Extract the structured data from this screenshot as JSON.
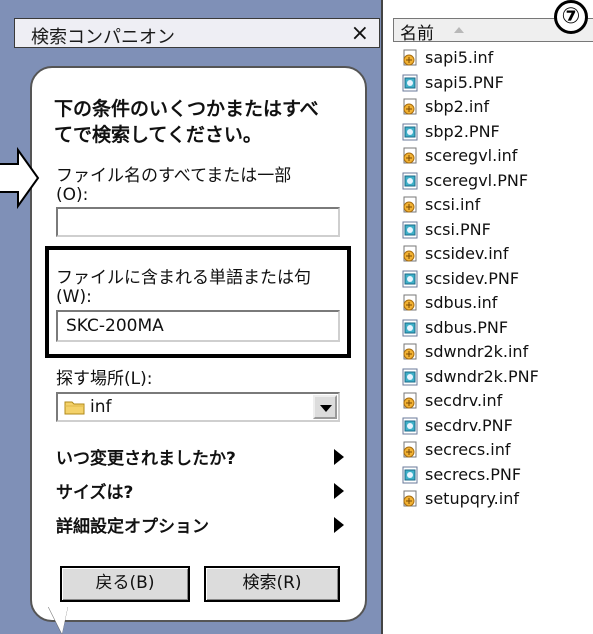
{
  "companion": {
    "title": "検索コンパニオン",
    "close_glyph": "×",
    "intro_line1": "下の条件のいくつかまたはすべ",
    "intro_line2": "てで検索してください。",
    "filename_label": "ファイル名のすべてまたは一部",
    "filename_hotkey": "(O):",
    "filename_value": "",
    "keyword_label": "ファイルに含まれる単語または句",
    "keyword_hotkey": "(W):",
    "keyword_value": "SKC-200MA",
    "location_label": "探す場所(L):",
    "location_value": "inf",
    "options": [
      {
        "label": "いつ変更されましたか?"
      },
      {
        "label": "サイズは?"
      },
      {
        "label": "詳細設定オプション"
      }
    ],
    "back_label": "戻る(B)",
    "search_label": "検索(R)"
  },
  "file_list": {
    "column_header": "名前",
    "files": [
      {
        "name": "sapi5.inf",
        "type": "inf"
      },
      {
        "name": "sapi5.PNF",
        "type": "pnf"
      },
      {
        "name": "sbp2.inf",
        "type": "inf"
      },
      {
        "name": "sbp2.PNF",
        "type": "pnf"
      },
      {
        "name": "sceregvl.inf",
        "type": "inf"
      },
      {
        "name": "sceregvl.PNF",
        "type": "pnf"
      },
      {
        "name": "scsi.inf",
        "type": "inf"
      },
      {
        "name": "scsi.PNF",
        "type": "pnf"
      },
      {
        "name": "scsidev.inf",
        "type": "inf"
      },
      {
        "name": "scsidev.PNF",
        "type": "pnf"
      },
      {
        "name": "sdbus.inf",
        "type": "inf"
      },
      {
        "name": "sdbus.PNF",
        "type": "pnf"
      },
      {
        "name": "sdwndr2k.inf",
        "type": "inf"
      },
      {
        "name": "sdwndr2k.PNF",
        "type": "pnf"
      },
      {
        "name": "secdrv.inf",
        "type": "inf"
      },
      {
        "name": "secdrv.PNF",
        "type": "pnf"
      },
      {
        "name": "secrecs.inf",
        "type": "inf"
      },
      {
        "name": "secrecs.PNF",
        "type": "pnf"
      },
      {
        "name": "setupqry.inf",
        "type": "inf"
      }
    ]
  },
  "step_badge": "⑦",
  "colors": {
    "pane_background": "#7f90b7",
    "highlight_border": "#000000"
  },
  "icons": {
    "folder": "folder-icon",
    "inf_file": "inf-file-icon",
    "pnf_file": "pnf-file-icon",
    "pointer": "pointer-arrow-icon"
  }
}
